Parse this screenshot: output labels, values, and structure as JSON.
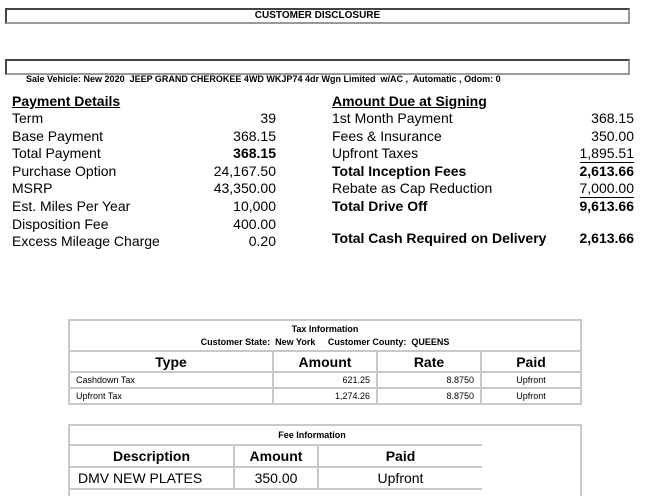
{
  "header": {
    "title": "CUSTOMER DISCLOSURE",
    "vehicle_line": "Sale Vehicle: New 2020  JEEP GRAND CHEROKEE 4WD WKJP74 4dr Wgn Limited  w/AC ,  Automatic , Odom: 0"
  },
  "payment_details": {
    "heading": "Payment Details",
    "rows": [
      {
        "label": "Term",
        "value": "39"
      },
      {
        "label": "Base Payment",
        "value": "368.15"
      },
      {
        "label": "Total Payment",
        "value": "368.15"
      },
      {
        "label": "Purchase Option",
        "value": "24,167.50"
      },
      {
        "label": "MSRP",
        "value": "43,350.00"
      },
      {
        "label": "Est. Miles Per Year",
        "value": "10,000"
      },
      {
        "label": "Disposition Fee",
        "value": "400.00"
      },
      {
        "label": "Excess Mileage Charge",
        "value": "0.20"
      }
    ]
  },
  "amount_due": {
    "heading": "Amount Due at Signing",
    "rows": [
      {
        "label": "1st Month Payment",
        "value": "368.15"
      },
      {
        "label": "Fees & Insurance",
        "value": "350.00"
      },
      {
        "label": "Upfront Taxes",
        "value": "1,895.51"
      },
      {
        "label": "Total Inception Fees",
        "value": "2,613.66"
      },
      {
        "label": "Rebate as Cap Reduction",
        "value": "7,000.00"
      },
      {
        "label": "Total Drive Off",
        "value": "9,613.66"
      }
    ],
    "total_cash": {
      "label": "Total Cash Required on Delivery",
      "value": "2,613.66"
    }
  },
  "tax_info": {
    "title": "Tax Information",
    "state_label": "Customer State:",
    "state": "New York",
    "county_label": "Customer County:",
    "county": "QUEENS",
    "columns": [
      "Type",
      "Amount",
      "Rate",
      "Paid"
    ],
    "rows": [
      {
        "type": "Cashdown Tax",
        "amount": "621.25",
        "rate": "8.8750",
        "paid": "Upfront"
      },
      {
        "type": "Upfront Tax",
        "amount": "1,274.26",
        "rate": "8.8750",
        "paid": "Upfront"
      }
    ]
  },
  "fee_info": {
    "title": "Fee Information",
    "columns": [
      "Description",
      "Amount",
      "Paid"
    ],
    "rows": [
      {
        "description": "DMV NEW PLATES",
        "amount": "350.00",
        "paid": "Upfront"
      }
    ]
  }
}
